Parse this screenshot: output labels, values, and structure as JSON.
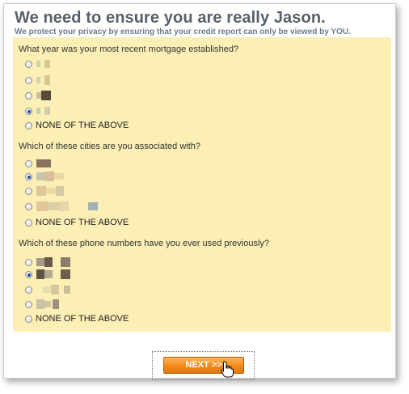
{
  "header": {
    "title": "We need to ensure you are really Jason.",
    "subtitle": "We protect your privacy by ensuring that your credit report can only be viewed by YOU."
  },
  "questions": [
    {
      "text": "What year was your most recent mortgage established?",
      "none_label": "NONE OF THE ABOVE",
      "selected_option": 4
    },
    {
      "text": "Which of these cities are you associated with?",
      "none_label": "NONE OF THE ABOVE",
      "selected_option": 2
    },
    {
      "text": "Which of these phone numbers have you ever used previously?",
      "none_label": "NONE OF THE ABOVE",
      "selected_option": 2
    }
  ],
  "redaction": "pixelated",
  "next_button": {
    "label": "NEXT >>"
  },
  "colors": {
    "panel_background": "#fbefb5",
    "title": "#57606a",
    "button": "#f28b1a"
  }
}
